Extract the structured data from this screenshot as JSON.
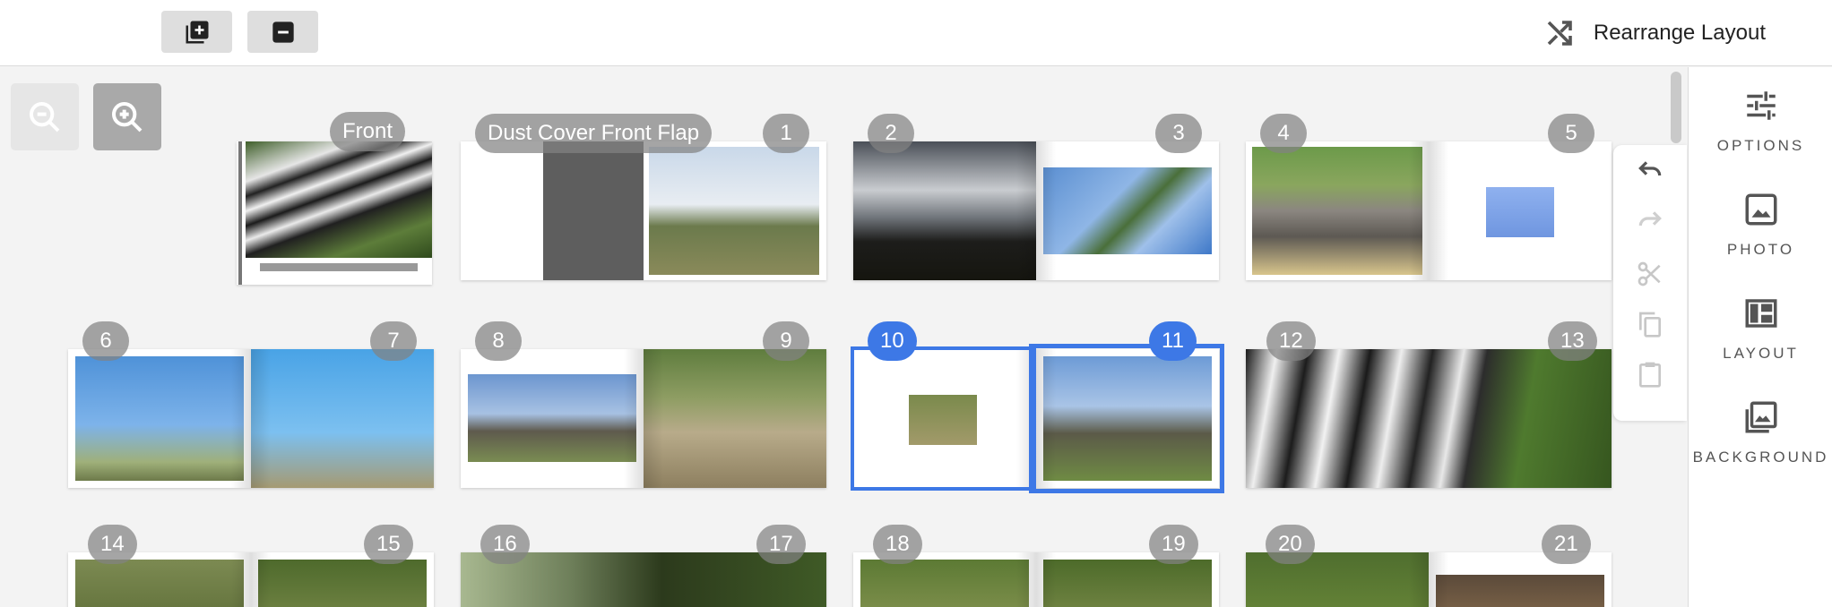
{
  "toolbar": {
    "add_page_icon": "add-page-icon",
    "remove_page_icon": "remove-page-icon",
    "rearrange_label": "Rearrange Layout",
    "rearrange_icon": "shuffle-icon"
  },
  "zoom": {
    "zoom_out_icon": "zoom-out-icon",
    "zoom_in_icon": "zoom-in-icon"
  },
  "cover": {
    "front_label": "Front",
    "flap_label": "Dust Cover Front Flap"
  },
  "pages": [
    "1",
    "2",
    "3",
    "4",
    "5",
    "6",
    "7",
    "8",
    "9",
    "10",
    "11",
    "12",
    "13",
    "14",
    "15",
    "16",
    "17",
    "18",
    "19",
    "20",
    "21"
  ],
  "selected_pages": [
    "10",
    "11"
  ],
  "edit_tools": [
    "undo-icon",
    "redo-icon",
    "cut-icon",
    "copy-icon",
    "paste-icon"
  ],
  "sidebar": {
    "items": [
      {
        "label": "OPTIONS",
        "icon": "sliders-icon"
      },
      {
        "label": "PHOTO",
        "icon": "image-icon"
      },
      {
        "label": "LAYOUT",
        "icon": "layout-icon"
      },
      {
        "label": "BACKGROUND",
        "icon": "background-icon"
      }
    ]
  },
  "colors": {
    "accent": "#3d78e6",
    "badge": "#828282"
  }
}
